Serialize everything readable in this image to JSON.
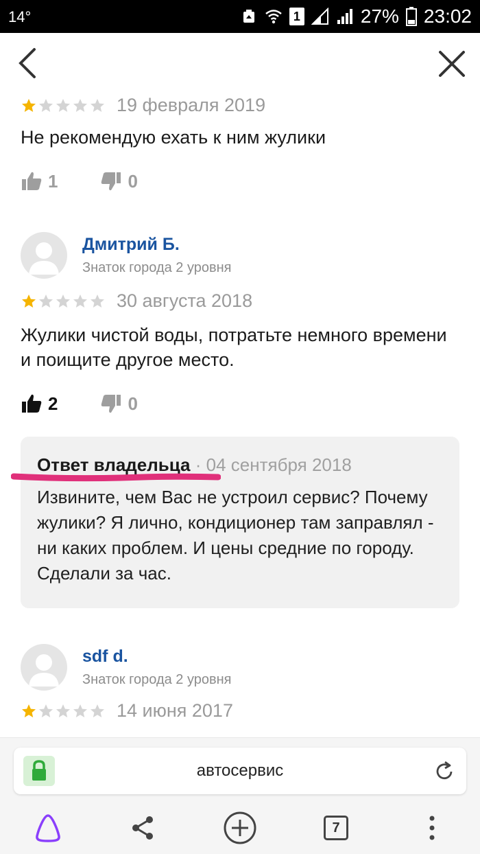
{
  "status_bar": {
    "temperature": "14°",
    "sim_badge": "1",
    "battery": "27%",
    "time": "23:02"
  },
  "reviews": [
    {
      "rating": 1,
      "date": "19 февраля 2019",
      "text": "Не рекомендую ехать к ним жулики",
      "likes": "1",
      "dislikes": "0"
    },
    {
      "author": "Дмитрий Б.",
      "level": "Знаток города 2 уровня",
      "rating": 1,
      "date": "30 августа 2018",
      "text": "Жулики чистой воды, потратьте немного времени и поищите другое место.",
      "likes": "2",
      "dislikes": "0",
      "owner_reply": {
        "label": "Ответ владельца",
        "separator": "·",
        "date": "04 сентября 2018",
        "text": "Извините, чем Вас не устроил сервис? Почему жулики? Я лично, кондиционер там заправлял - ни каких проблем. И цены средние по городу. Сделали за час."
      }
    },
    {
      "author": "sdf d.",
      "level": "Знаток города 2 уровня",
      "rating": 1,
      "date": "14 июня 2017"
    }
  ],
  "browser": {
    "url_text": "автосервис",
    "tabs_count": "7"
  },
  "colors": {
    "star_filled": "#f5b400",
    "star_empty": "#d4d4d4",
    "author_link": "#1a54a0",
    "marker": "#e0307a",
    "lock_green": "#2faa3a",
    "alice_purple": "#8a3ffc"
  },
  "icons": [
    "back-arrow-icon",
    "close-icon",
    "thumbs-up-icon",
    "thumbs-down-icon",
    "avatar-silhouette-icon",
    "lock-icon",
    "reload-icon",
    "alice-icon",
    "share-icon",
    "plus-icon",
    "tabs-icon",
    "more-icon"
  ]
}
